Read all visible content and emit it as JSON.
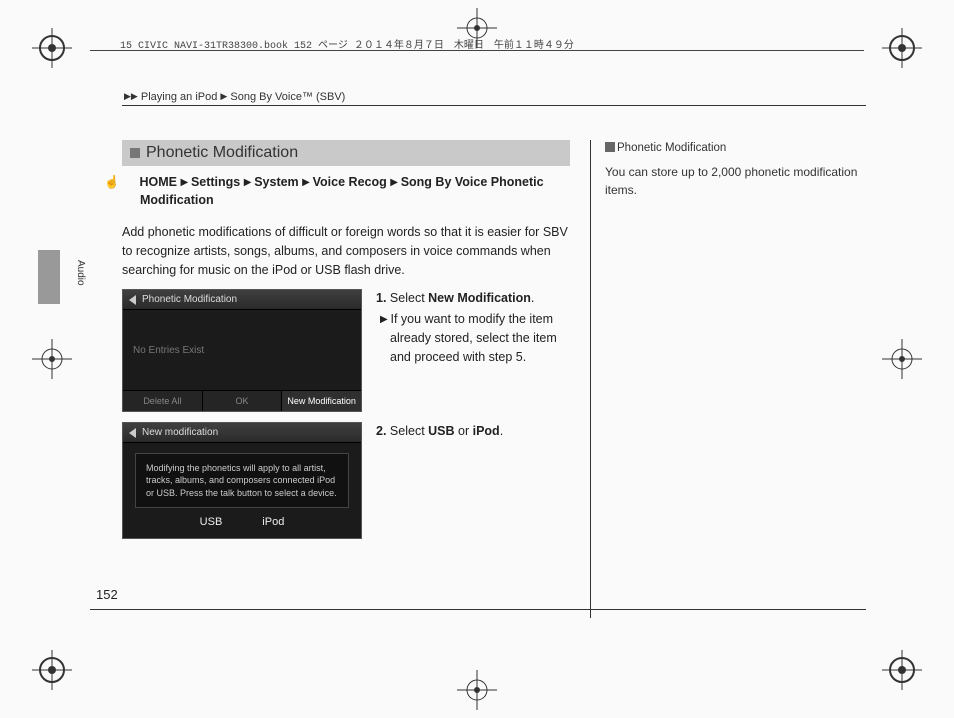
{
  "doc_header": "15 CIVIC NAVI-31TR38300.book  152 ページ  ２０１４年８月７日　木曜日　午前１１時４９分",
  "breadcrumb": {
    "a": "Playing an iPod",
    "b": "Song By Voice™ (SBV)"
  },
  "section_title": "Phonetic Modification",
  "nav_path": {
    "home": "HOME",
    "settings": "Settings",
    "system": "System",
    "voice_recog": "Voice Recog",
    "tail": "Song By Voice Phonetic Modification"
  },
  "intro": "Add phonetic modifications of difficult or foreign words so that it is easier for SBV to recognize artists, songs, albums, and composers in voice commands when searching for music on the iPod or USB flash drive.",
  "step1": {
    "num": "1.",
    "pre": "Select ",
    "target": "New Modification",
    "post": ".",
    "sub": "If you want to modify the item already stored, select the item and proceed with step 5."
  },
  "ss1": {
    "title": "Phonetic Modification",
    "body": "No Entries Exist",
    "btn1": "Delete All",
    "btn2": "OK",
    "btn3": "New Modification"
  },
  "step2": {
    "num": "2.",
    "pre": "Select ",
    "a": "USB",
    "mid": " or ",
    "b": "iPod",
    "post": "."
  },
  "ss2": {
    "title": "New modification",
    "msg": "Modifying the phonetics will apply to all artist, tracks, albums, and composers connected iPod or USB. Press the talk button to select a device.",
    "btn_usb": "USB",
    "btn_ipod": "iPod"
  },
  "sidebar": {
    "heading": "Phonetic Modification",
    "body": "You can store up to 2,000 phonetic modification items."
  },
  "tab": "Audio",
  "pagenum": "152"
}
